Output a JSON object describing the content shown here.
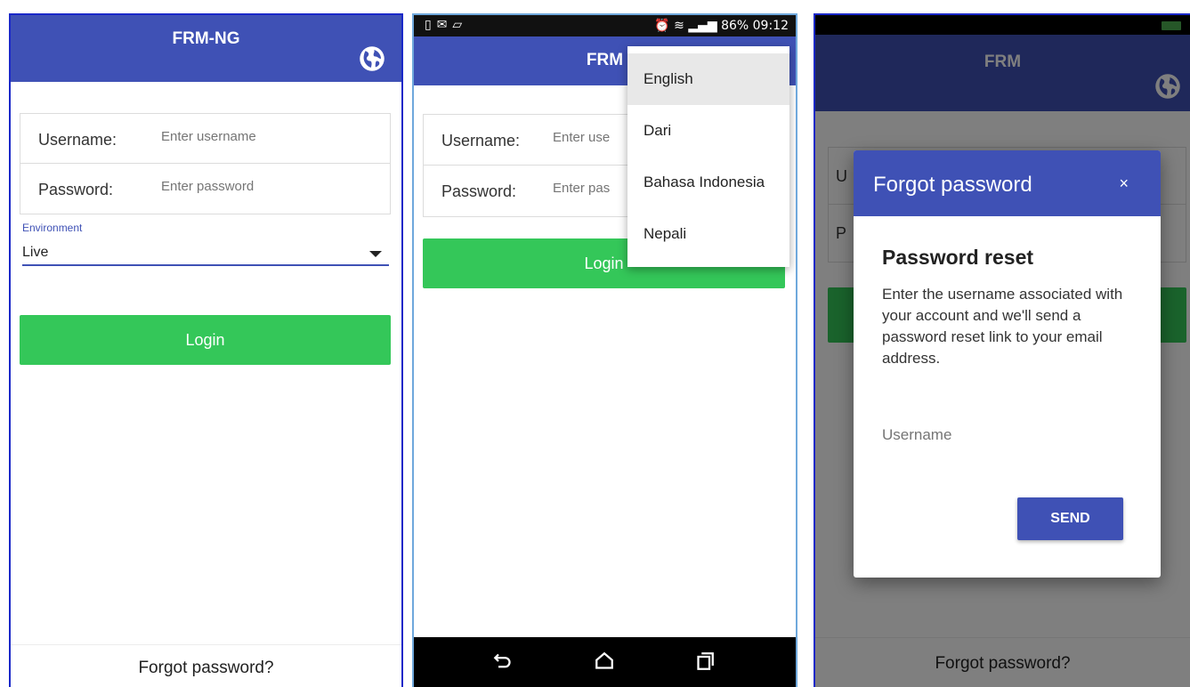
{
  "panel1": {
    "appbar_title": "FRM-NG",
    "username_label": "Username:",
    "username_placeholder": "Enter username",
    "password_label": "Password:",
    "password_placeholder": "Enter password",
    "environment_label": "Environment",
    "environment_value": "Live",
    "login_label": "Login",
    "forgot_label": "Forgot password?"
  },
  "panel2": {
    "status_right": "86% 09:12",
    "appbar_title": "FRM",
    "username_label": "Username:",
    "username_placeholder": "Enter use",
    "password_label": "Password:",
    "password_placeholder": "Enter pas",
    "login_label": "Login",
    "language_menu": [
      "English",
      "Dari",
      "Bahasa Indonesia",
      "Nepali"
    ],
    "selected_language": "English"
  },
  "panel3": {
    "appbar_title": "FRM",
    "row1_label_fragment": "U",
    "row2_label_fragment": "P",
    "forgot_label": "Forgot password?",
    "dialog": {
      "title": "Forgot password",
      "close": "×",
      "heading": "Password reset",
      "text": "Enter the username associated with your account and we'll send a password reset link to your email address.",
      "username_placeholder": "Username",
      "send_label": "SEND"
    }
  },
  "icons": {
    "globe": "globe-icon",
    "back": "back-icon",
    "home": "home-icon",
    "recents": "recents-icon"
  },
  "colors": {
    "primary": "#3f51b5",
    "login_green": "#34c759",
    "panel_border": "#1a28c8"
  }
}
